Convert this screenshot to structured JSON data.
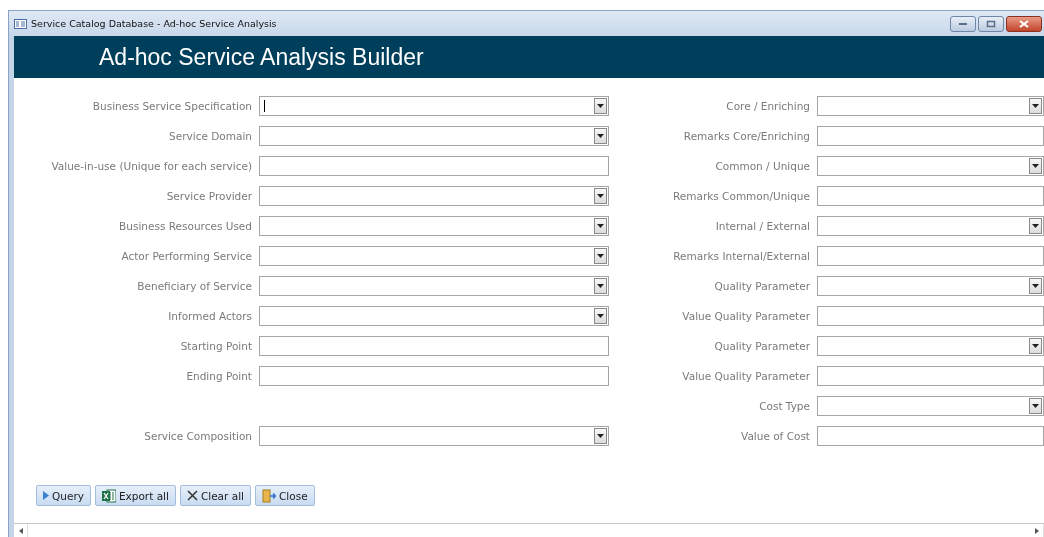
{
  "window": {
    "title": "Service Catalog Database - Ad-hoc Service Analysis"
  },
  "header": {
    "title": "Ad-hoc Service Analysis Builder"
  },
  "rows": [
    {
      "left": {
        "label": "Business Service Specification",
        "kind": "dropdown",
        "focused": true
      },
      "right": {
        "label": "Core / Enriching",
        "kind": "dropdown",
        "focused": false
      }
    },
    {
      "left": {
        "label": "Service Domain",
        "kind": "dropdown",
        "focused": false
      },
      "right": {
        "label": "Remarks Core/Enriching",
        "kind": "text",
        "focused": false
      }
    },
    {
      "left": {
        "label": "Value-in-use (Unique for each service)",
        "kind": "text",
        "focused": false
      },
      "right": {
        "label": "Common / Unique",
        "kind": "dropdown",
        "focused": false
      }
    },
    {
      "left": {
        "label": "Service Provider",
        "kind": "dropdown",
        "focused": false
      },
      "right": {
        "label": "Remarks Common/Unique",
        "kind": "text",
        "focused": false
      }
    },
    {
      "left": {
        "label": "Business Resources Used",
        "kind": "dropdown",
        "focused": false
      },
      "right": {
        "label": "Internal / External",
        "kind": "dropdown",
        "focused": false
      }
    },
    {
      "left": {
        "label": "Actor Performing Service",
        "kind": "dropdown",
        "focused": false
      },
      "right": {
        "label": "Remarks Internal/External",
        "kind": "text",
        "focused": false
      }
    },
    {
      "left": {
        "label": "Beneficiary of Service",
        "kind": "dropdown",
        "focused": false
      },
      "right": {
        "label": "Quality Parameter",
        "kind": "dropdown",
        "focused": false
      }
    },
    {
      "left": {
        "label": "Informed Actors",
        "kind": "dropdown",
        "focused": false
      },
      "right": {
        "label": "Value Quality Parameter",
        "kind": "text",
        "focused": false
      }
    },
    {
      "left": {
        "label": "Starting Point",
        "kind": "text",
        "focused": false
      },
      "right": {
        "label": "Quality Parameter",
        "kind": "dropdown",
        "focused": false
      }
    },
    {
      "left": {
        "label": "Ending Point",
        "kind": "text",
        "focused": false
      },
      "right": {
        "label": "Value Quality Parameter",
        "kind": "text",
        "focused": false
      }
    },
    {
      "right": {
        "label": "Cost Type",
        "kind": "dropdown",
        "focused": false
      }
    },
    {
      "left": {
        "label": "Service Composition",
        "kind": "dropdown",
        "focused": false
      },
      "right": {
        "label": "Value of Cost",
        "kind": "text",
        "focused": false
      }
    }
  ],
  "buttons": [
    {
      "label": "Query",
      "kind": "play"
    },
    {
      "label": "Export all",
      "kind": "excel"
    },
    {
      "label": "Clear all",
      "kind": "clear"
    },
    {
      "label": "Close",
      "kind": "door"
    }
  ]
}
